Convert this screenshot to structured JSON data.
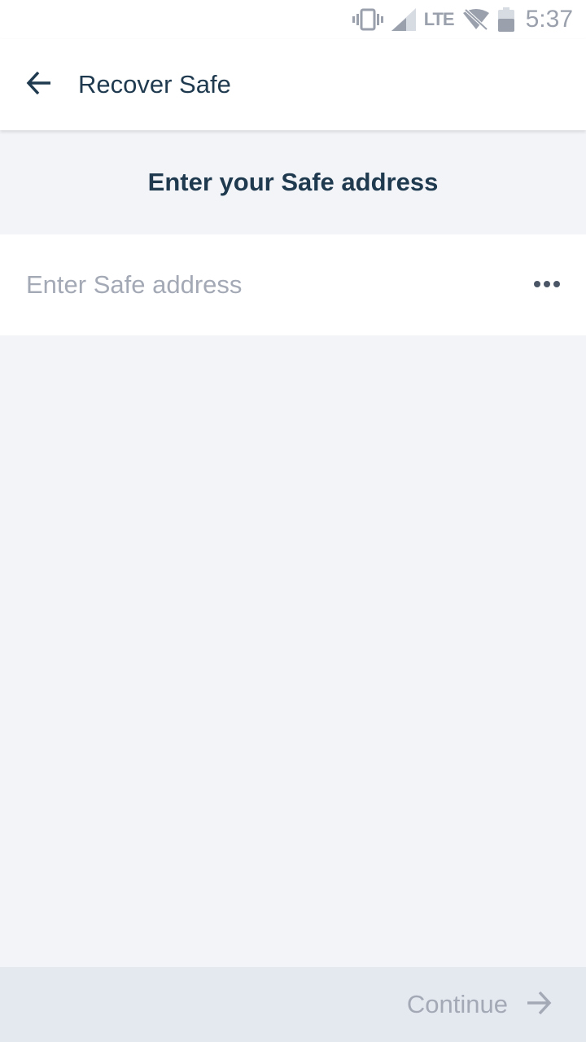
{
  "status_bar": {
    "network_label": "LTE",
    "time": "5:37",
    "icons": [
      "vibrate-icon",
      "cell-signal-icon",
      "wifi-off-icon",
      "battery-icon"
    ]
  },
  "app_bar": {
    "title": "Recover Safe",
    "back_icon": "arrow-left-icon"
  },
  "content": {
    "heading": "Enter your Safe address",
    "address_input": {
      "value": "",
      "placeholder": "Enter Safe address",
      "more_icon": "more-horizontal-icon"
    }
  },
  "footer": {
    "continue_label": "Continue",
    "continue_icon": "arrow-right-icon",
    "continue_enabled": false
  },
  "colors": {
    "primary_text": "#1f3a4f",
    "muted_text": "#a4a9b6",
    "background": "#f2f4f8",
    "footer_background": "#e4e8ef"
  }
}
